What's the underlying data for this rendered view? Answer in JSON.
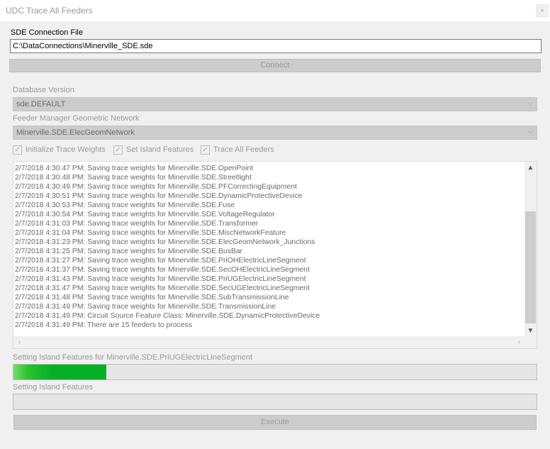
{
  "window": {
    "title": "UDC Trace All Feeders",
    "close_glyph": "×"
  },
  "sde": {
    "label": "SDE Connection File",
    "value": "C:\\DataConnections\\Minerville_SDE.sde",
    "connect_label": "Connect"
  },
  "database": {
    "label": "Database Version",
    "selected": "sde.DEFAULT"
  },
  "network": {
    "label": "Feeder Manager Geometric Network",
    "selected": "Minerville.SDE.ElecGeomNetwork"
  },
  "options": [
    {
      "label": "Initialize Trace Weights",
      "checked": true
    },
    {
      "label": "Set Island Features",
      "checked": true
    },
    {
      "label": "Trace All Feeders",
      "checked": true
    }
  ],
  "log": [
    "2/7/2018 4:30:47 PM: Saving trace weights for Minerville.SDE.OpenPoint",
    "2/7/2018 4:30:48 PM: Saving trace weights for Minerville.SDE.Streetlight",
    "2/7/2018 4:30:49 PM: Saving trace weights for Minerville.SDE.PFCorrectingEquipment",
    "2/7/2018 4:30:51 PM: Saving trace weights for Minerville.SDE.DynamicProtectiveDevice",
    "2/7/2018 4:30:53 PM: Saving trace weights for Minerville.SDE.Fuse",
    "2/7/2018 4:30:54 PM: Saving trace weights for Minerville.SDE.VoltageRegulator",
    "2/7/2018 4:31:03 PM: Saving trace weights for Minerville.SDE.Transformer",
    "2/7/2018 4:31:04 PM: Saving trace weights for Minerville.SDE.MiscNetworkFeature",
    "2/7/2018 4:31:23 PM: Saving trace weights for Minerville.SDE.ElecGeomNetwork_Junctions",
    "2/7/2018 4:31:25 PM: Saving trace weights for Minerville.SDE.BusBar",
    "2/7/2018 4:31:27 PM: Saving trace weights for Minerville.SDE.PriOHElectricLineSegment",
    "2/7/2018 4:31:37 PM: Saving trace weights for Minerville.SDE.SecOHElectricLineSegment",
    "2/7/2018 4:31:43 PM: Saving trace weights for Minerville.SDE.PriUGElectricLineSegment",
    "2/7/2018 4:31:47 PM: Saving trace weights for Minerville.SDE.SecUGElectricLineSegment",
    "2/7/2018 4:31:48 PM: Saving trace weights for Minerville.SDE.SubTransmissionLine",
    "2/7/2018 4:31:49 PM: Saving trace weights for Minerville.SDE.TransmissionLine",
    "2/7/2018 4:31:49 PM: Circuit Source Feature Class: Minerville.SDE.DynamicProtectiveDevice",
    "2/7/2018 4:31:49 PM: There are 15 feeders to process"
  ],
  "progress1": {
    "label": "Setting Island Features for Minerville.SDE.PriUGElectricLineSegment",
    "fraction": 0.178
  },
  "progress2": {
    "label": "Setting Island Features",
    "fraction": 0
  },
  "execute_label": "Execute",
  "glyphs": {
    "check": "✓",
    "dropdown": "⌵",
    "up": "▲",
    "down": "▼",
    "left": "‹",
    "right": "›"
  },
  "colors": {
    "progress_fill": "#06b025",
    "disabled_text": "#9a9a9a",
    "control_bg": "#cccccc"
  }
}
